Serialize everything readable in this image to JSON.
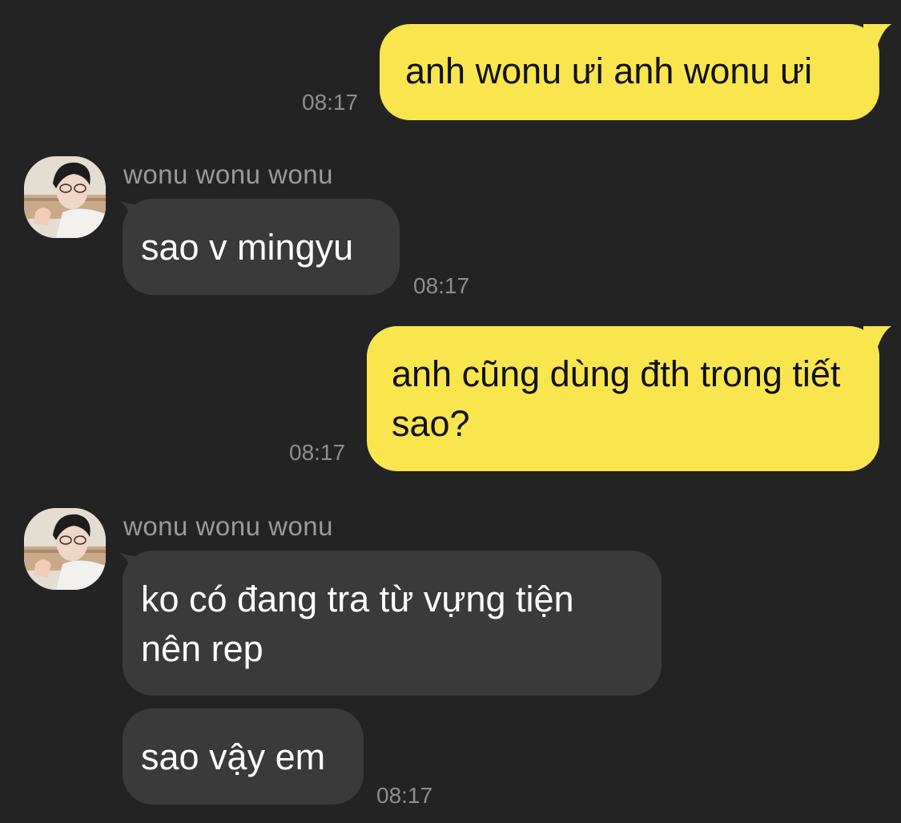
{
  "colors": {
    "background": "#232323",
    "sent_bubble": "#f9e54e",
    "received_bubble": "#3a3a3b",
    "timestamp": "#8e8e8e",
    "sender_name": "#9a9a9a"
  },
  "messages": [
    {
      "direction": "sent",
      "text": "anh wonu ưi anh wonu ưi",
      "time": "08:17"
    },
    {
      "direction": "received",
      "sender": "wonu wonu wonu",
      "text": "sao v mingyu",
      "time": "08:17"
    },
    {
      "direction": "sent",
      "text": "anh cũng dùng đth trong tiết sao?",
      "time": "08:17"
    },
    {
      "direction": "received",
      "sender": "wonu wonu wonu",
      "text": "ko có đang tra từ vựng tiện nên rep"
    },
    {
      "direction": "received",
      "text": "sao vậy em",
      "time": "08:17"
    }
  ]
}
